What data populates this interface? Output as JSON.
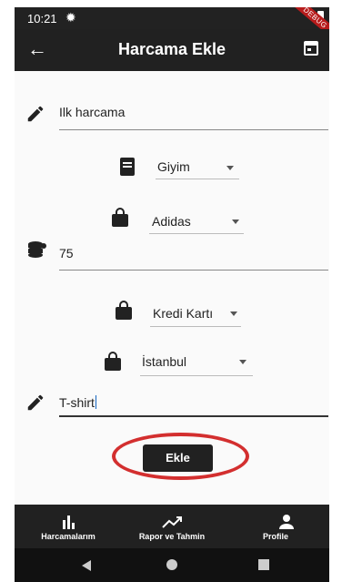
{
  "status_bar": {
    "time": "10:21",
    "debug_banner": "DEBUG"
  },
  "app_bar": {
    "title": "Harcama Ekle"
  },
  "form": {
    "title_field": {
      "value": "Ilk harcama"
    },
    "category_dropdown": {
      "selected": "Giyim"
    },
    "brand_dropdown": {
      "selected": "Adidas"
    },
    "amount_field": {
      "value": "75"
    },
    "payment_dropdown": {
      "selected": "Kredi Kartı"
    },
    "city_dropdown": {
      "selected": "İstanbul"
    },
    "note_field": {
      "value": "T-shirt"
    },
    "submit_label": "Ekle"
  },
  "bottom_nav": {
    "items": [
      {
        "label": "Harcamalarım",
        "icon": "bar-chart-icon"
      },
      {
        "label": "Rapor ve Tahmin",
        "icon": "trending-up-icon"
      },
      {
        "label": "Profile",
        "icon": "person-icon"
      }
    ]
  },
  "colors": {
    "bar": "#212121",
    "highlight": "#d32f2f",
    "background": "#fafafa"
  }
}
